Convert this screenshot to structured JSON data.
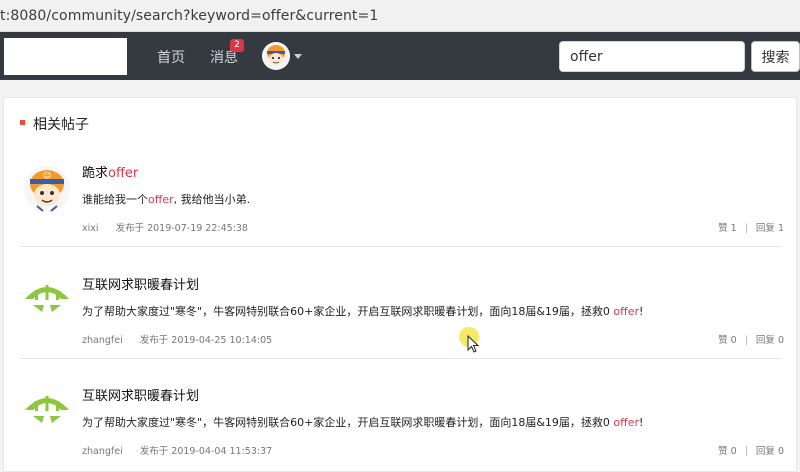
{
  "browser": {
    "url": "t:8080/community/search?keyword=offer&current=1"
  },
  "navbar": {
    "home_label": "首页",
    "messages_label": "消息",
    "messages_badge": "2",
    "search_value": "offer",
    "search_button_label": "搜索"
  },
  "section": {
    "title": "相关帖子"
  },
  "posts": [
    {
      "title_pre": "跪求",
      "title_hl": "offer",
      "content_pre": "谁能给我一个",
      "content_hl": "offer",
      "content_post": ", 我给他当小弟.",
      "author": "xixi",
      "time": "发布于 2019-07-19 22:45:38",
      "likes": "赞 1",
      "replies": "回复 1"
    },
    {
      "title": "互联网求职暖春计划",
      "content_pre": "为了帮助大家度过\"寒冬\"，牛客网特别联合60+家企业，开启互联网求职暖春计划，面向18届&19届，拯救0 ",
      "content_hl": "offer",
      "content_post": "!",
      "author": "zhangfei",
      "time": "发布于 2019-04-25 10:14:05",
      "likes": "赞 0",
      "replies": "回复 0"
    },
    {
      "title": "互联网求职暖春计划",
      "content_pre": "为了帮助大家度过\"寒冬\"，牛客网特别联合60+家企业，开启互联网求职暖春计划，面向18届&19届，拯救0 ",
      "content_hl": "offer",
      "content_post": "!",
      "author": "zhangfei",
      "time": "发布于 2019-04-04 11:53:37",
      "likes": "赞 0",
      "replies": "回复 0"
    }
  ],
  "colors": {
    "navbar": "#343a40",
    "highlight": "#dc3545",
    "accent_marker": "#ee4b3a",
    "nowcoder_green": "#8dc63f"
  }
}
